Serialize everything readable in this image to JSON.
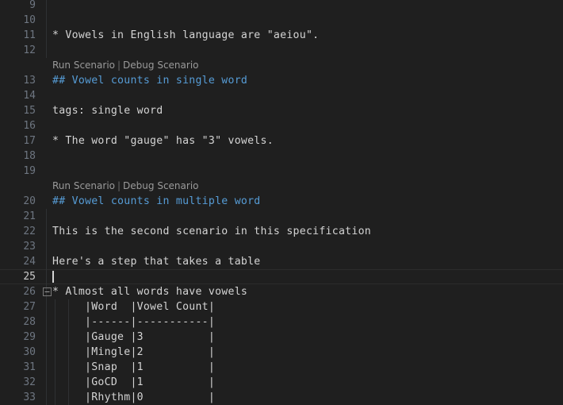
{
  "editor": {
    "theme_background": "#1f1f1f",
    "foreground": "#d4d4d4",
    "line_number_color": "#6e7681",
    "active_line_number_color": "#cccccc",
    "heading_color": "#569cd6",
    "codelens_color": "#8a8a8a",
    "indent_guide_color": "#2f3133",
    "current_line": 25,
    "line_height": 19,
    "font_size": 13
  },
  "codelens": {
    "run_label": "Run Scenario",
    "separator": "|",
    "debug_label": "Debug Scenario"
  },
  "fold": {
    "collapse_label": "collapse"
  },
  "lines": [
    {
      "number": "9",
      "text": ""
    },
    {
      "number": "10",
      "text": ""
    },
    {
      "number": "11",
      "text": "* Vowels in English language are \"aeiou\"."
    },
    {
      "number": "12",
      "text": ""
    },
    {
      "number": "13",
      "text": "## Vowel counts in single word",
      "kind": "heading",
      "codelens": true
    },
    {
      "number": "14",
      "text": ""
    },
    {
      "number": "15",
      "text": "tags: single word"
    },
    {
      "number": "16",
      "text": ""
    },
    {
      "number": "17",
      "text": "* The word \"gauge\" has \"3\" vowels."
    },
    {
      "number": "18",
      "text": ""
    },
    {
      "number": "19",
      "text": ""
    },
    {
      "number": "20",
      "text": "## Vowel counts in multiple word",
      "kind": "heading",
      "codelens": true
    },
    {
      "number": "21",
      "text": ""
    },
    {
      "number": "22",
      "text": "This is the second scenario in this specification"
    },
    {
      "number": "23",
      "text": ""
    },
    {
      "number": "24",
      "text": "Here's a step that takes a table"
    },
    {
      "number": "25",
      "text": "",
      "active": true
    },
    {
      "number": "26",
      "text": "* Almost all words have vowels",
      "fold": true
    },
    {
      "number": "27",
      "text": "     |Word  |Vowel Count|"
    },
    {
      "number": "28",
      "text": "     |------|-----------|"
    },
    {
      "number": "29",
      "text": "     |Gauge |3          |"
    },
    {
      "number": "30",
      "text": "     |Mingle|2          |"
    },
    {
      "number": "31",
      "text": "     |Snap  |1          |"
    },
    {
      "number": "32",
      "text": "     |GoCD  |1          |"
    },
    {
      "number": "33",
      "text": "     |Rhythm|0          |"
    }
  ],
  "table_data": {
    "headers": [
      "Word",
      "Vowel Count"
    ],
    "rows": [
      [
        "Gauge",
        "3"
      ],
      [
        "Mingle",
        "2"
      ],
      [
        "Snap",
        "1"
      ],
      [
        "GoCD",
        "1"
      ],
      [
        "Rhythm",
        "0"
      ]
    ]
  }
}
